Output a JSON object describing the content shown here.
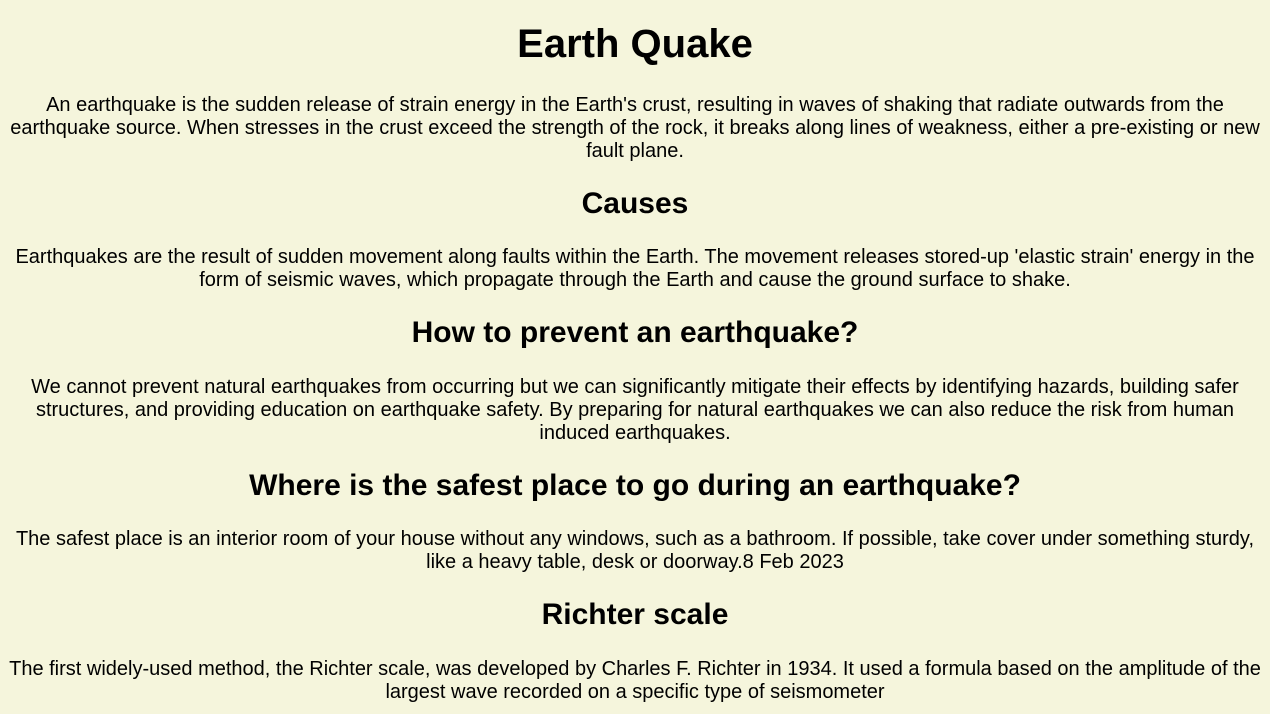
{
  "page": {
    "title": "Earth Quake",
    "intro": "An earthquake is the sudden release of strain energy in the Earth's crust, resulting in waves of shaking that radiate outwards from the earthquake source. When stresses in the crust exceed the strength of the rock, it breaks along lines of weakness, either a pre-existing or new fault plane."
  },
  "sections": [
    {
      "heading": "Causes",
      "body": "Earthquakes are the result of sudden movement along faults within the Earth. The movement releases stored-up 'elastic strain' energy in the form of seismic waves, which propagate through the Earth and cause the ground surface to shake."
    },
    {
      "heading": "How to prevent an earthquake?",
      "body": "We cannot prevent natural earthquakes from occurring but we can significantly mitigate their effects by identifying hazards, building safer structures, and providing education on earthquake safety. By preparing for natural earthquakes we can also reduce the risk from human induced earthquakes."
    },
    {
      "heading": "Where is the safest place to go during an earthquake?",
      "body": "The safest place is an interior room of your house without any windows, such as a bathroom. If possible, take cover under something sturdy, like a heavy table, desk or doorway.8 Feb 2023"
    },
    {
      "heading": "Richter scale",
      "body": "The first widely-used method, the Richter scale, was developed by Charles F. Richter in 1934. It used a formula based on the amplitude of the largest wave recorded on a specific type of seismometer"
    }
  ]
}
